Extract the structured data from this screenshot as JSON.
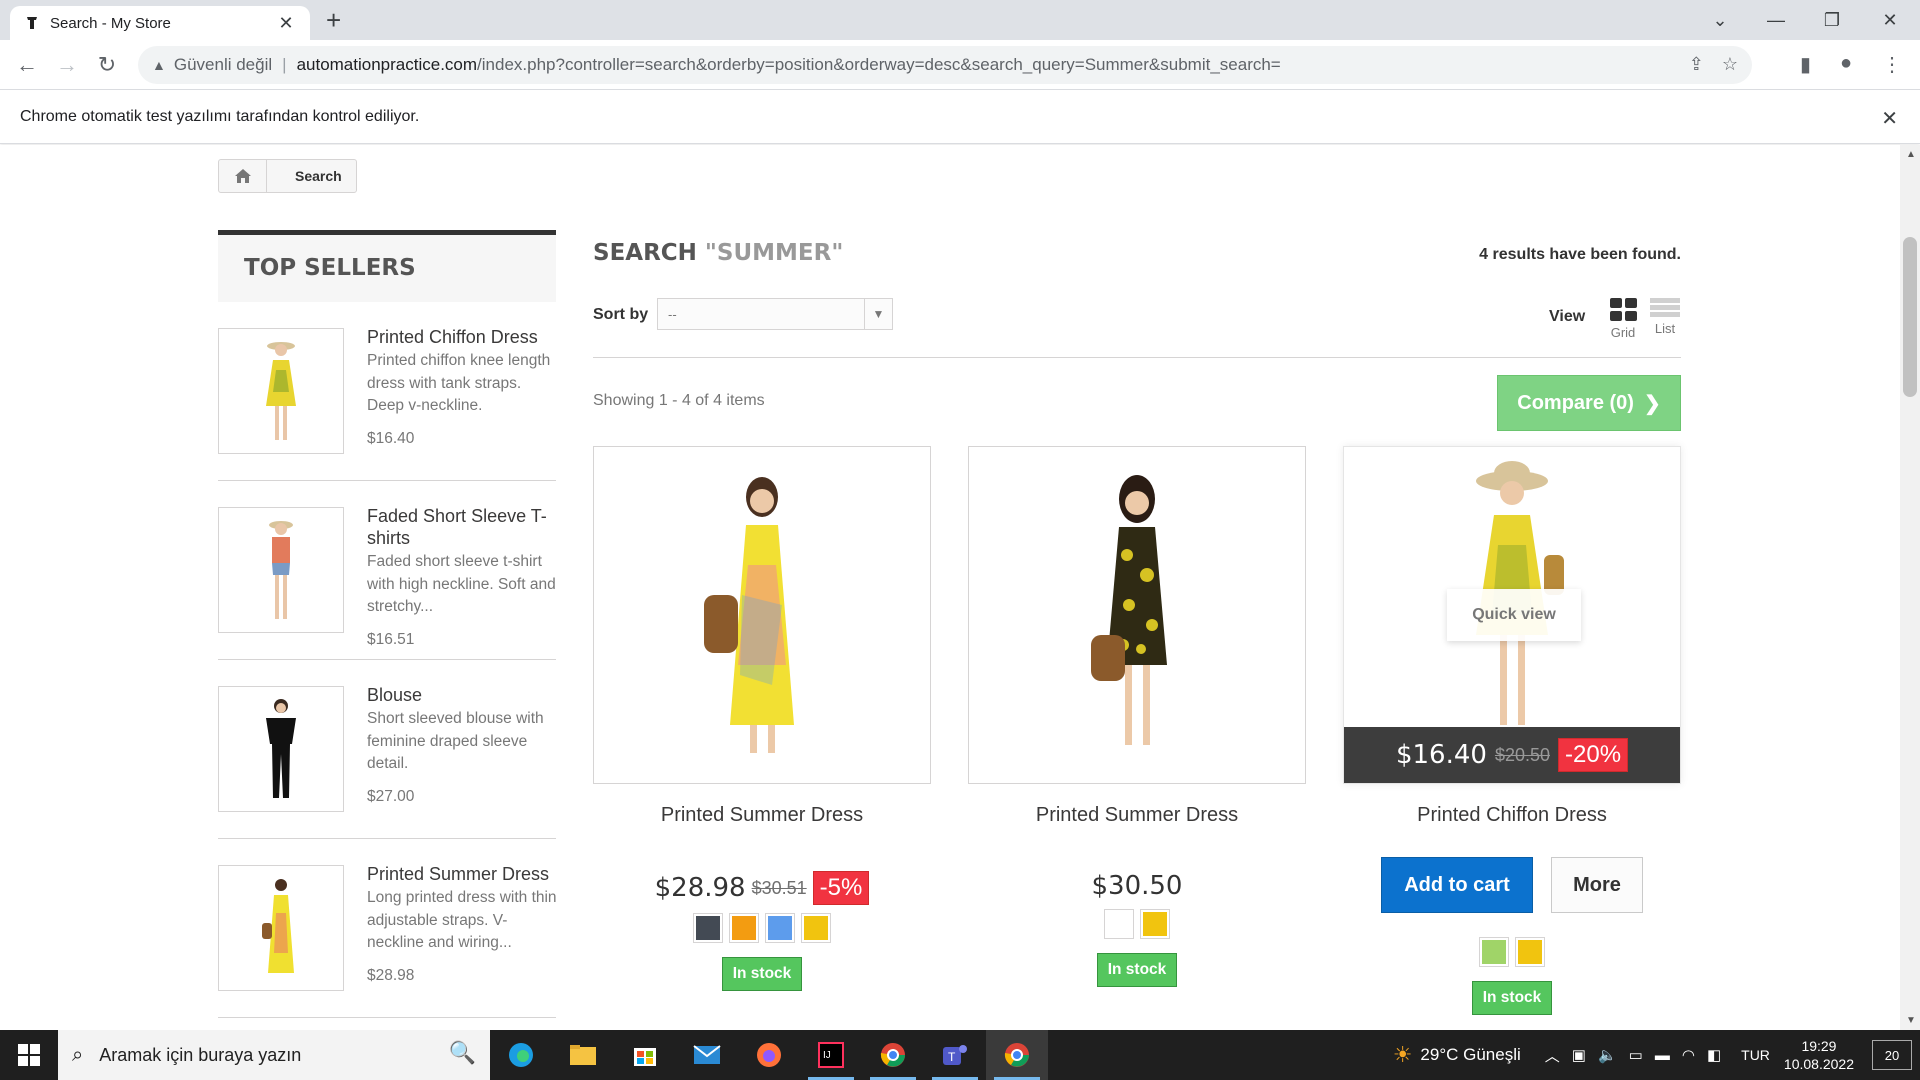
{
  "browser": {
    "tab_title": "Search - My Store",
    "new_tab": "+",
    "security_label": "Güvenli değil",
    "url_host": "automationpractice.com",
    "url_rest": "/index.php?controller=search&orderby=position&orderway=desc&search_query=Summer&submit_search=",
    "infobar_text": "Chrome otomatik test yazılımı tarafından kontrol ediliyor."
  },
  "breadcrumb": {
    "current": "Search"
  },
  "sidebar": {
    "title": "TOP SELLERS",
    "items": [
      {
        "name": "Printed Chiffon Dress",
        "desc": "Printed chiffon knee length dress with tank straps. Deep v-neckline.",
        "price": "$16.40"
      },
      {
        "name": "Faded Short Sleeve T-shirts",
        "desc": "Faded short sleeve t-shirt with high neckline. Soft and stretchy...",
        "price": "$16.51"
      },
      {
        "name": "Blouse",
        "desc": "Short sleeved blouse with feminine draped sleeve detail.",
        "price": "$27.00"
      },
      {
        "name": "Printed Summer Dress",
        "desc": "Long printed dress with thin adjustable straps. V-neckline and wiring...",
        "price": "$28.98"
      }
    ]
  },
  "main": {
    "search_title": "SEARCH",
    "search_query": "\"SUMMER\"",
    "results_count": "4 results have been found.",
    "sort_label": "Sort by",
    "sort_value": "--",
    "view_label": "View",
    "view_grid": "Grid",
    "view_list": "List",
    "showing": "Showing 1 - 4 of 4 items",
    "compare_label": "Compare (0)"
  },
  "products": [
    {
      "name": "Printed Summer Dress",
      "price": "$28.98",
      "old_price": "$30.51",
      "reduction": "-5%",
      "stock": "In stock",
      "colors": [
        "#434a54",
        "#f39c11",
        "#5d9cec",
        "#f1c40f"
      ]
    },
    {
      "name": "Printed Summer Dress",
      "price": "$30.50",
      "stock": "In stock",
      "colors": [
        "#ffffff",
        "#f1c40f"
      ]
    },
    {
      "name": "Printed Chiffon Dress",
      "price": "$16.40",
      "old_price": "$20.50",
      "reduction": "-20%",
      "quick_view": "Quick view",
      "add_to_cart": "Add to cart",
      "more": "More",
      "stock": "In stock",
      "colors": [
        "#a0d468",
        "#f1c40f"
      ]
    }
  ],
  "taskbar": {
    "search_placeholder": "Aramak için buraya yazın",
    "weather": "29°C  Güneşli",
    "lang": "TUR",
    "time": "19:29",
    "date": "10.08.2022",
    "notifications": "20"
  }
}
